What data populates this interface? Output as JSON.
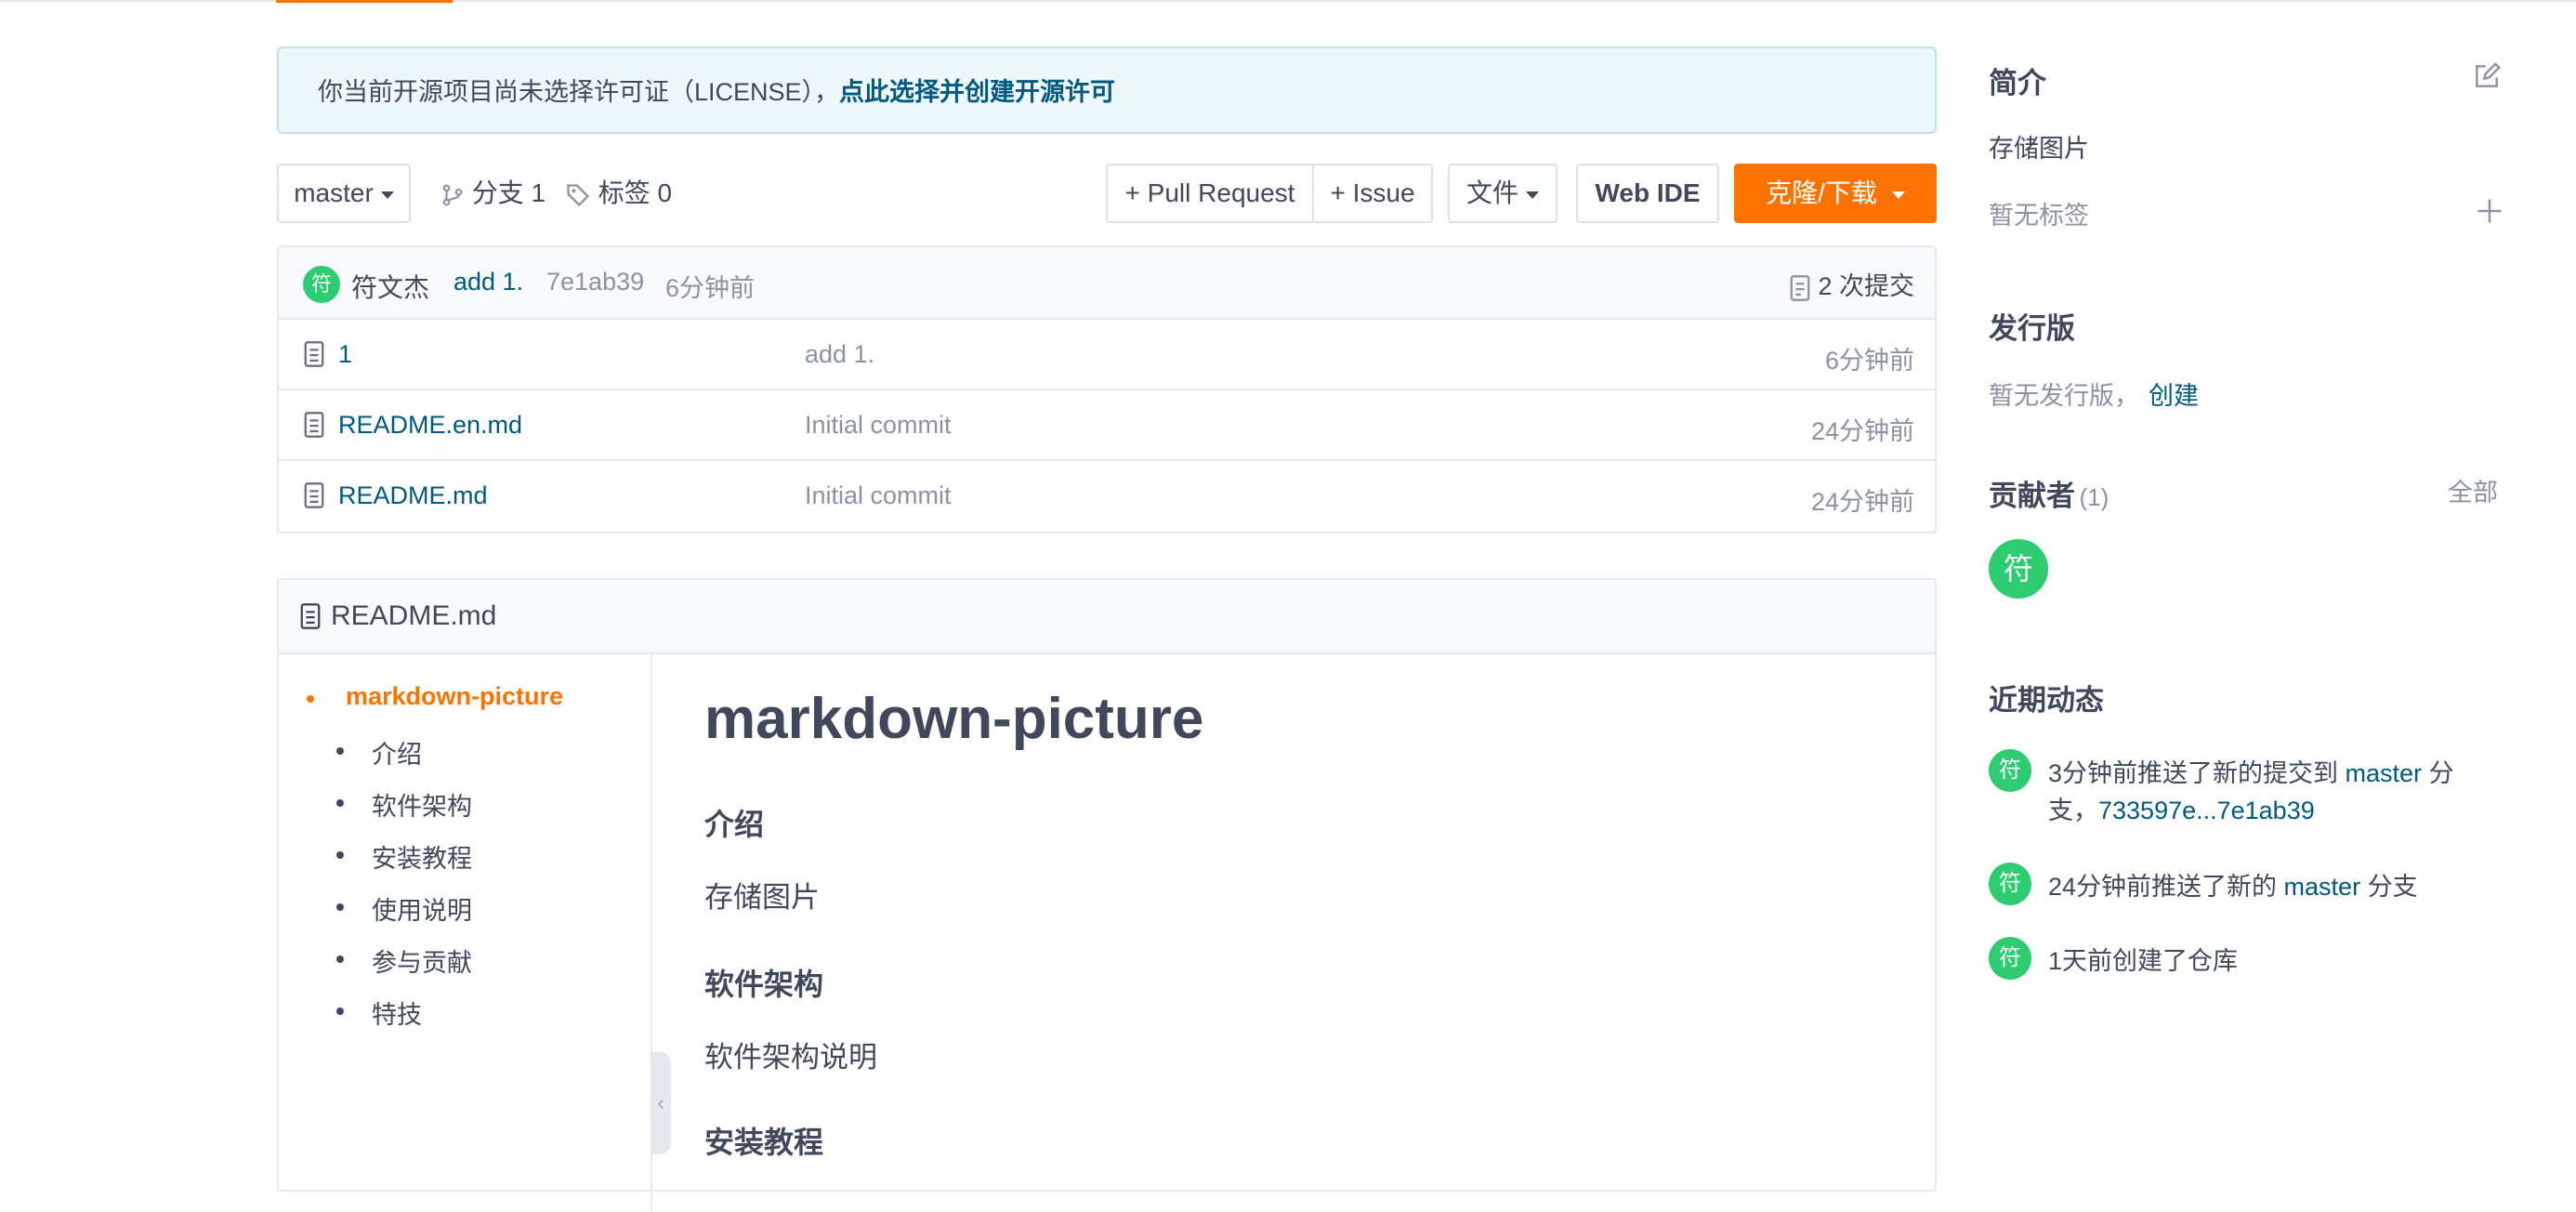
{
  "banner": {
    "text": "你当前开源项目尚未选择许可证（LICENSE），",
    "link": "点此选择并创建开源许可"
  },
  "toolbar": {
    "branch": "master",
    "branches": "分支 1",
    "tags": "标签 0",
    "pull_request": "+ Pull Request",
    "issue": "+ Issue",
    "file": "文件",
    "web_ide": "Web IDE",
    "clone": "克隆/下载"
  },
  "commit": {
    "avatar": "符",
    "author": "符文杰",
    "message": "add 1.",
    "hash": "7e1ab39",
    "time": "6分钟前",
    "count": "2 次提交"
  },
  "files": [
    {
      "name": "1",
      "message": "add 1.",
      "time": "6分钟前"
    },
    {
      "name": "README.en.md",
      "message": "Initial commit",
      "time": "24分钟前"
    },
    {
      "name": "README.md",
      "message": "Initial commit",
      "time": "24分钟前"
    }
  ],
  "readme": {
    "filename": "README.md",
    "toc": {
      "root": "markdown-picture",
      "items": [
        "介绍",
        "软件架构",
        "安装教程",
        "使用说明",
        "参与贡献",
        "特技"
      ]
    },
    "h1": "markdown-picture",
    "sections": [
      {
        "heading": "介绍",
        "body": "存储图片"
      },
      {
        "heading": "软件架构",
        "body": "软件架构说明"
      },
      {
        "heading": "安装教程",
        "body": ""
      }
    ],
    "collapse_glyph": "‹"
  },
  "sidebar": {
    "intro_title": "简介",
    "intro_text": "存储图片",
    "no_tags": "暂无标签",
    "release_title": "发行版",
    "no_release": "暂无发行版，",
    "create": "创建",
    "contrib_title": "贡献者",
    "contrib_count": "(1)",
    "contrib_all": "全部",
    "contrib_avatar": "符",
    "activity_title": "近期动态",
    "activity": [
      {
        "avatar": "符",
        "pre": "3分钟前推送了新的提交到 ",
        "branch": "master",
        "mid": " 分",
        "line2_pre": "支，",
        "line2_link": "733597e...7e1ab39"
      },
      {
        "avatar": "符",
        "pre": "24分钟前推送了新的 ",
        "branch": "master",
        "post": " 分支"
      },
      {
        "avatar": "符",
        "text": "1天前创建了仓库"
      }
    ]
  },
  "colors": {
    "accent": "#fe7300",
    "link": "#005980",
    "avatar": "#2ecc71",
    "banner_bg": "#eef8fa"
  }
}
